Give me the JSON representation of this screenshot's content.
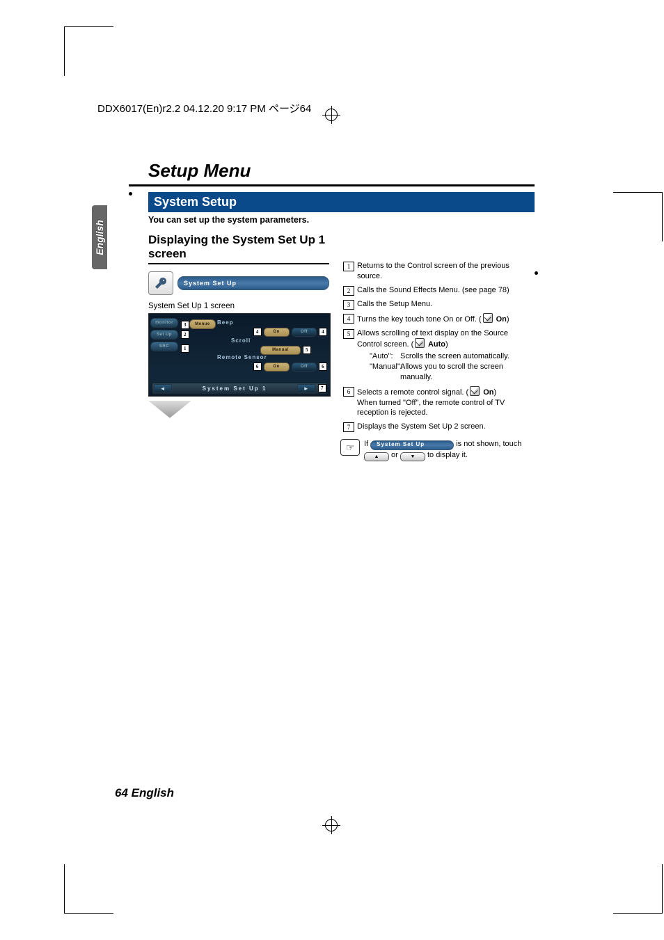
{
  "print_tag": "DDX6017(En)r2.2  04.12.20  9:17 PM  ページ64",
  "lang_tab": "English",
  "title_main": "Setup Menu",
  "section_bar": "System Setup",
  "intro": "You can set up the system parameters.",
  "sub_head": "Displaying the System Set Up 1 screen",
  "menu_pill": "System Set Up",
  "caption_screen": "System Set Up 1 screen",
  "screen": {
    "left_buttons": [
      "monitor",
      "Set Up",
      "SRC"
    ],
    "menue_tab": "Menue",
    "rows": [
      {
        "label": "Beep",
        "opts": [
          "On",
          "Off"
        ],
        "gold_index": 0,
        "tags": [
          "4",
          "4"
        ]
      },
      {
        "label": "Scroll",
        "opts": [
          "Manual"
        ],
        "gold_index": 0,
        "tags": [
          "5"
        ]
      },
      {
        "label": "Remote Sensor",
        "opts": [
          "On",
          "Off"
        ],
        "gold_index": 0,
        "tags": [
          "6",
          "6"
        ]
      }
    ],
    "status_bar": "System Set Up 1",
    "status_tag": "7",
    "left_tags": {
      "2": "2",
      "3": "3",
      "1": "1"
    }
  },
  "items": [
    {
      "n": "1",
      "text": "Returns to the Control screen of the previous source."
    },
    {
      "n": "2",
      "text": "Calls the Sound Effects Menu. (see page 78)"
    },
    {
      "n": "3",
      "text": "Calls the Setup Menu."
    },
    {
      "n": "4",
      "text": "Turns the key touch tone On or Off. (",
      "pen": true,
      "after": " On)"
    },
    {
      "n": "5",
      "text": "Allows scrolling of text display on the Source Control screen. (",
      "pen": true,
      "after": " Auto)",
      "sub": [
        {
          "k": "\"Auto\":",
          "v": "Scrolls the screen automatically."
        },
        {
          "k": "\"Manual\":",
          "v": "Allows you to scroll the screen manually."
        }
      ]
    },
    {
      "n": "6",
      "text": "Selects a remote control signal. (",
      "pen": true,
      "after": " On)",
      "extra": "When turned \"Off\", the remote control of TV reception is rejected."
    },
    {
      "n": "7",
      "text": "Displays the System Set Up 2 screen."
    }
  ],
  "note": {
    "pre": "If ",
    "pill": "System Set Up",
    "mid": " is not shown, touch ",
    "btn1": "▲",
    "or": " or ",
    "btn2": "▼",
    "post": " to display it."
  },
  "footer": "64 English"
}
